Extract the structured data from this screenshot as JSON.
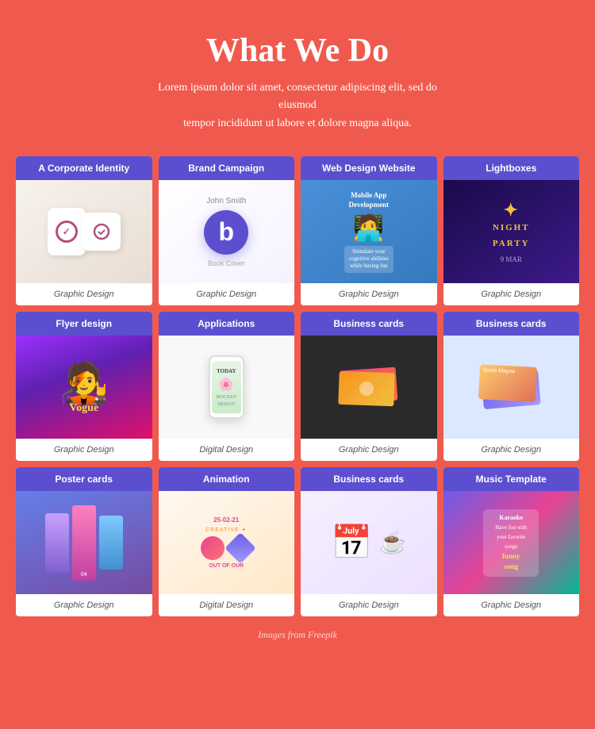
{
  "page": {
    "title": "What We Do",
    "subtitle": "Lorem ipsum dolor sit amet, consectetur adipiscing elit, sed do eiusmod\ntempor incididunt ut labore et dolore magna aliqua.",
    "footer_note": "Images from Freepik"
  },
  "cards": [
    {
      "id": "corporate",
      "header": "A Corporate Identity",
      "label": "Graphic Design",
      "image_type": "corporate"
    },
    {
      "id": "brand",
      "header": "Brand Campaign",
      "label": "Graphic Design",
      "image_type": "brand"
    },
    {
      "id": "webdesign",
      "header": "Web Design Website",
      "label": "Graphic Design",
      "image_type": "webdesign"
    },
    {
      "id": "lightbox",
      "header": "Lightboxes",
      "label": "Graphic Design",
      "image_type": "lightbox"
    },
    {
      "id": "flyer",
      "header": "Flyer design",
      "label": "Graphic Design",
      "image_type": "flyer"
    },
    {
      "id": "apps",
      "header": "Applications",
      "label": "Digital Design",
      "image_type": "apps"
    },
    {
      "id": "bizcard1",
      "header": "Business cards",
      "label": "Graphic Design",
      "image_type": "bizcard1"
    },
    {
      "id": "bizcard2",
      "header": "Business cards",
      "label": "Graphic Design",
      "image_type": "bizcard2"
    },
    {
      "id": "poster",
      "header": "Poster cards",
      "label": "Graphic Design",
      "image_type": "poster"
    },
    {
      "id": "animation",
      "header": "Animation",
      "label": "Digital Design",
      "image_type": "animation"
    },
    {
      "id": "bizcard3",
      "header": "Business cards",
      "label": "Graphic Design",
      "image_type": "bizcard3"
    },
    {
      "id": "music",
      "header": "Music Template",
      "label": "Graphic Design",
      "image_type": "music"
    }
  ],
  "colors": {
    "background": "#f05a4e",
    "card_header": "#5b4fcf",
    "white": "#ffffff"
  }
}
